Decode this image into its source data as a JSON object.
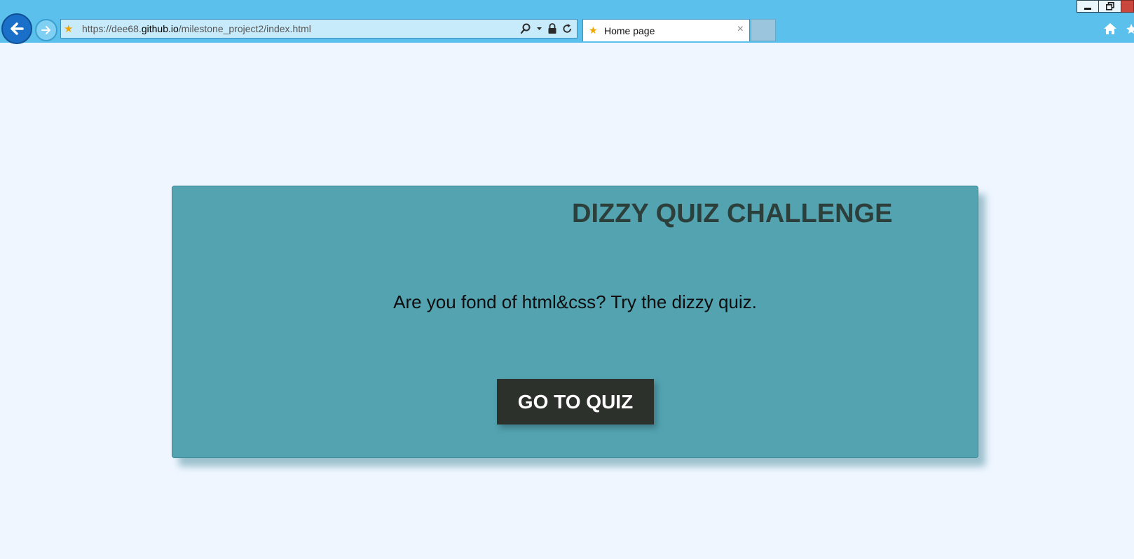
{
  "browser": {
    "url_scheme": "https://",
    "url_host_prefix": "dee68.",
    "url_host": "github.io",
    "url_path": "/milestone_project2/index.html",
    "tab_title": "Home page",
    "tab_close": "×"
  },
  "icons": {
    "back": "back-arrow-icon",
    "forward": "forward-arrow-icon",
    "favicon": "star-favicon-icon",
    "search": "search-icon",
    "dropdown": "chevron-down-icon",
    "lock": "lock-icon",
    "refresh": "refresh-icon",
    "home": "home-icon",
    "favorites": "star-icon"
  },
  "page": {
    "title": "DIZZY QUIZ CHALLENGE",
    "text": "Are you fond of html&css? Try the dizzy quiz.",
    "button_label": "GO TO QUIZ"
  },
  "colors": {
    "browser_chrome": "#5bc0ec",
    "page_background": "#eff6ff",
    "card_background": "#53a3b1",
    "title_text": "#2c3f3a",
    "button_background": "#2d312c",
    "button_text": "#ffffff"
  }
}
